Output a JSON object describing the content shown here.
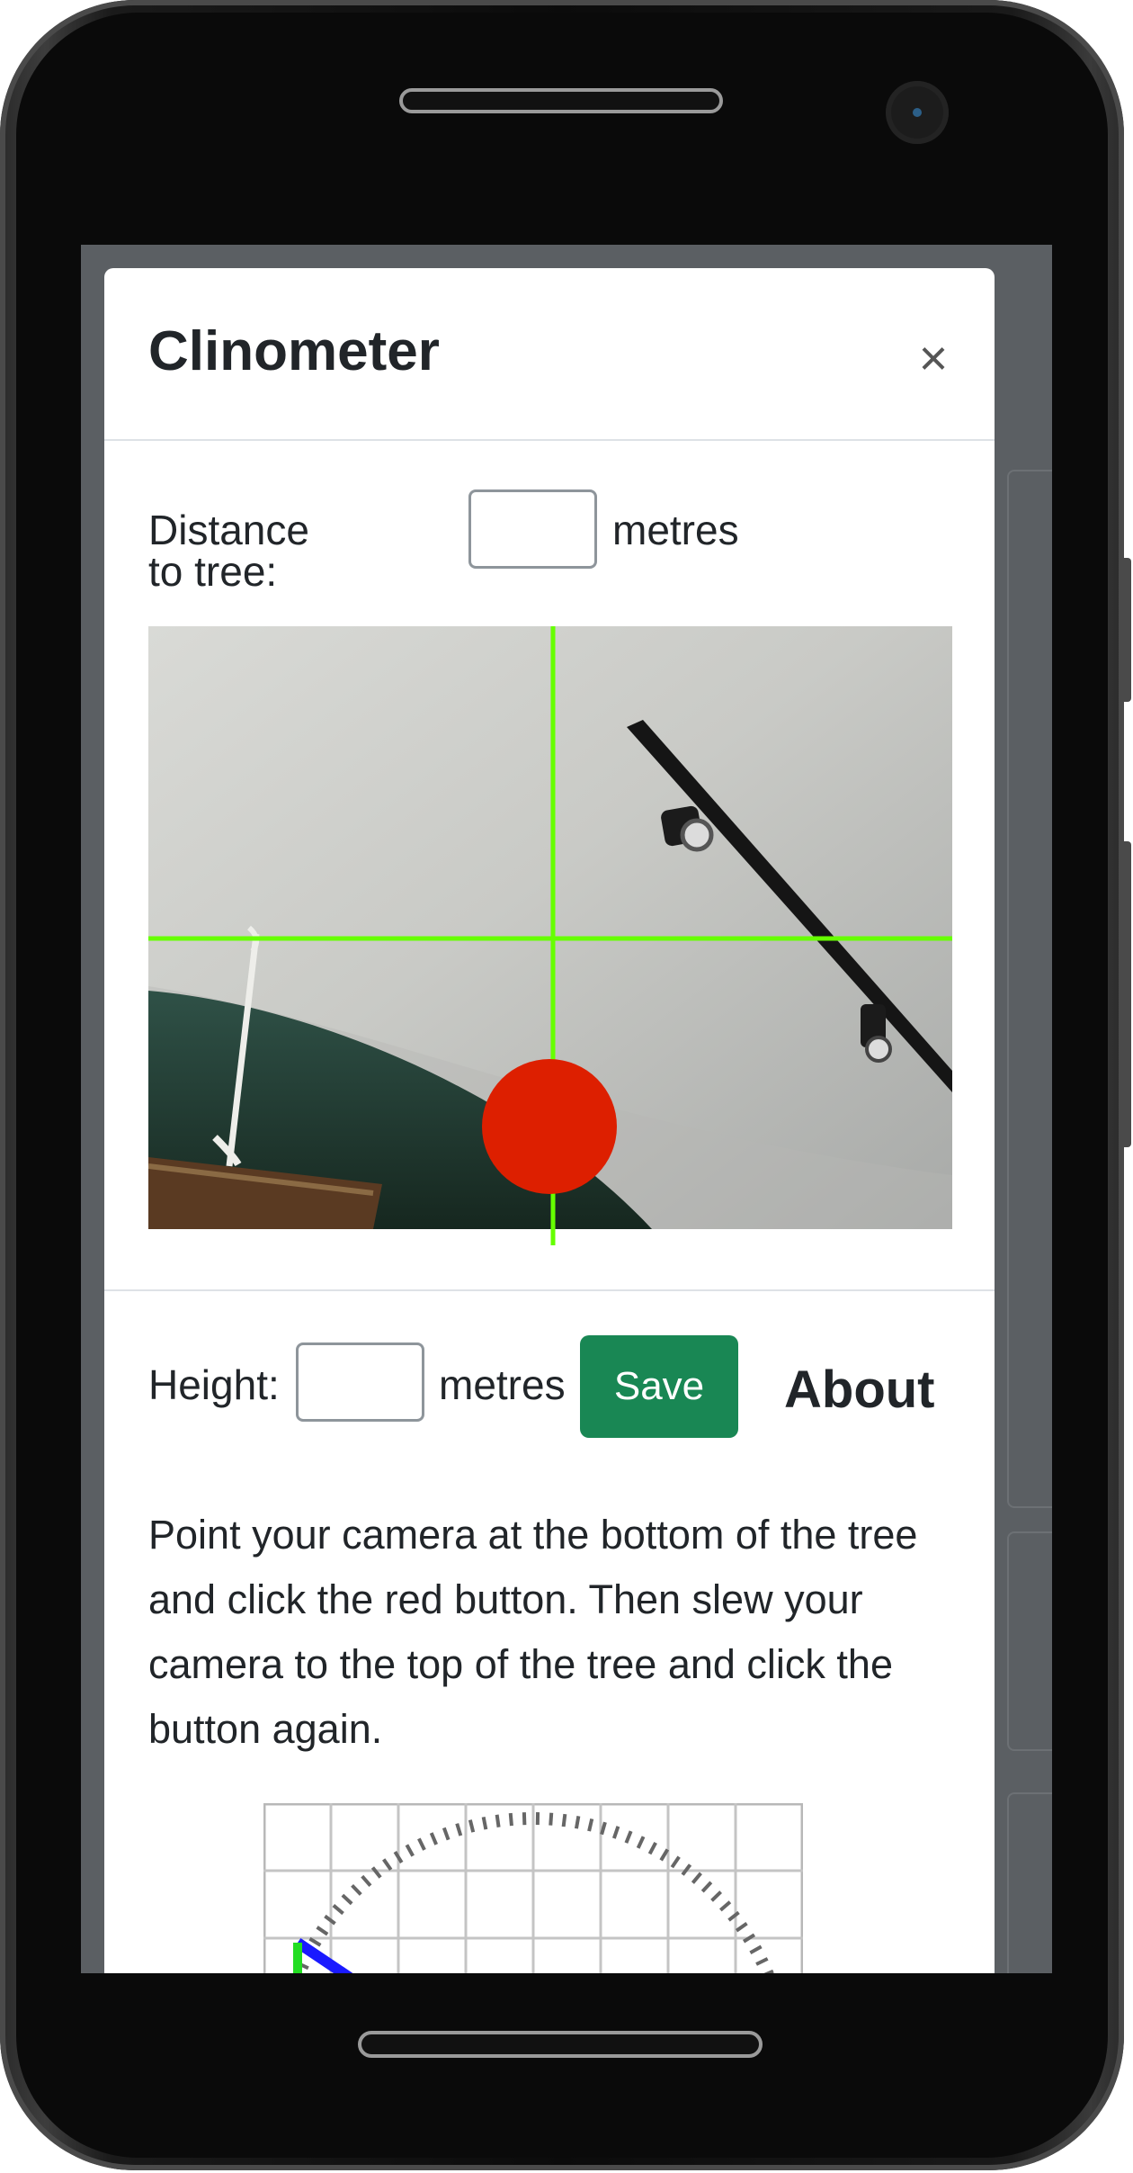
{
  "dialog": {
    "title": "Clinometer",
    "close_label": "×"
  },
  "distance": {
    "label": "Distance to tree:",
    "value": "",
    "unit": "metres"
  },
  "height": {
    "label": "Height:",
    "value": "",
    "unit": "metres"
  },
  "save_label": "Save",
  "about": {
    "heading": "About",
    "text": "Point your camera at the bottom of the tree and click the red button. Then slew your camera to the top of the tree and click the button again."
  },
  "colors": {
    "crosshair": "#66ff00",
    "capture_button": "#dd1f00",
    "save_button": "#198754",
    "dial_line_blue": "#1a1aff",
    "dial_line_green": "#22dd22"
  },
  "icons": {
    "close": "close-icon",
    "capture": "capture-button"
  }
}
